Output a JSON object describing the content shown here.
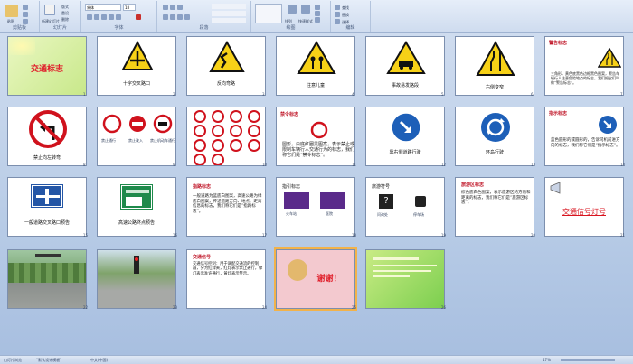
{
  "ribbon": {
    "groups": [
      "剪贴板",
      "幻灯片",
      "字体",
      "段落",
      "绘图",
      "编辑"
    ],
    "buttons": [
      "粘贴",
      "新建幻灯片",
      "版式",
      "重设",
      "删除",
      "形状",
      "排列",
      "快速样式",
      "查找",
      "替换",
      "选择"
    ],
    "font_name": "宋体",
    "font_size": "18"
  },
  "slides": [
    {
      "n": "1",
      "caption": "交通标志"
    },
    {
      "n": "2",
      "caption": "十字交叉路口"
    },
    {
      "n": "3",
      "caption": "反向弯路"
    },
    {
      "n": "4",
      "caption": "注意儿童"
    },
    {
      "n": "5",
      "caption": "事故易发路段"
    },
    {
      "n": "6",
      "caption": "右侧变窄"
    },
    {
      "n": "7",
      "title": "警告标志",
      "text": "三角形，黄色底黑色边框黑色图案，警告车辆行人注意危险地点的标志，我们把它们叫做“警告标志”。"
    },
    {
      "n": "8",
      "caption": "禁止向左转弯"
    },
    {
      "n": "9",
      "labels": [
        "禁止通行",
        "禁止驶入",
        "禁止机动车通行"
      ]
    },
    {
      "n": "10",
      "caption": ""
    },
    {
      "n": "11",
      "title": "禁令标志",
      "text": "圆形，白底红圈黑图案，表示禁止或限制车辆行人交通行为的标志，我们称它们是“禁令标志”。"
    },
    {
      "n": "12",
      "caption": "靠右侧道路行驶"
    },
    {
      "n": "13",
      "caption": "环岛行驶"
    },
    {
      "n": "14",
      "title": "指示标志",
      "text": "蓝色圆形的或圆形的，告诉司机前进方向的标志，我们称它们是“指示标志”。"
    },
    {
      "n": "15",
      "caption": "一般道路交叉路口预告"
    },
    {
      "n": "16",
      "caption": "高速公路终点预告"
    },
    {
      "n": "17",
      "title": "指路标志",
      "text": "一般道路为蓝底白图案，高速公路为绿底白图案，传递道路方向、地点、距离信息的标志，我们称它们是“指路标志”。"
    },
    {
      "n": "18",
      "title": "指引标志",
      "labels": [
        "火车站",
        "医院"
      ]
    },
    {
      "n": "19",
      "title": "旅游符号",
      "labels": [
        "问询处",
        "停车场"
      ]
    },
    {
      "n": "20",
      "title": "旅游区标志",
      "text": "棕色底白色图案，表示旅游区的方向和距离的标志，我们称它们是“旅游区标志”。"
    },
    {
      "n": "21",
      "caption": "交通信号灯号"
    },
    {
      "n": "22",
      "caption": ""
    },
    {
      "n": "23",
      "caption": ""
    },
    {
      "n": "24",
      "title": "交通信号",
      "text": "交通信号控制：用于调配交通流的控制器，分为红绿黄，红灯表示禁止通行，绿灯表示准许通行，黄灯表示警示。"
    },
    {
      "n": "25",
      "caption": "谢谢！"
    },
    {
      "n": "26",
      "caption": ""
    }
  ],
  "status": {
    "slide_view": "幻灯片浏览",
    "theme": "“默认设计模板”",
    "lang": "中文(中国)",
    "zoom": "47%"
  }
}
